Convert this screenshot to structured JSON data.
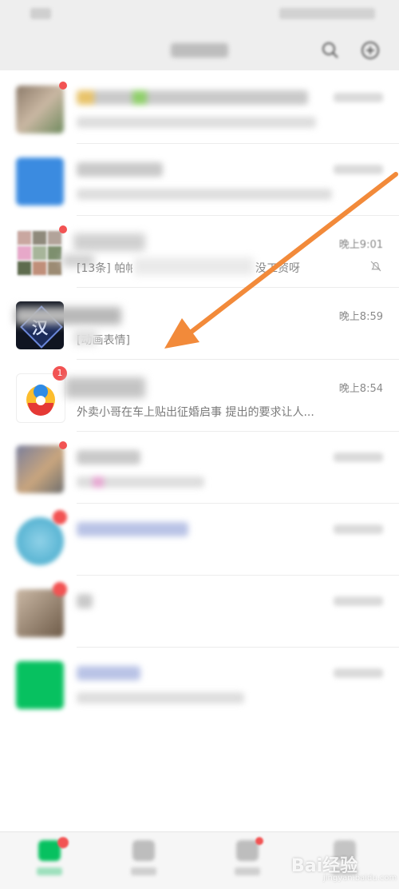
{
  "colors": {
    "wechat_green": "#07c160",
    "badge_red": "#f25353",
    "annotation_arrow": "#f28a3a",
    "topbar_bg": "#eeeeee"
  },
  "chats": {
    "row3": {
      "preview": "[13条] 帕帕",
      "preview_end": "没工资呀",
      "time": "晚上9:01",
      "icon": "bell-muted-icon"
    },
    "row4": {
      "preview": "[动画表情]",
      "time": "晚上8:59",
      "avatar_char": "汉"
    },
    "row5": {
      "badge": "1",
      "preview": "外卖小哥在车上贴出征婚启事 提出的要求让人...",
      "time": "晚上8:54"
    }
  },
  "watermark": {
    "brand": "Bai经验",
    "sub": "jingyan.baidu.com"
  },
  "icons": {
    "search": "search-icon",
    "add": "plus-icon",
    "arrow": "annotation-arrow"
  }
}
